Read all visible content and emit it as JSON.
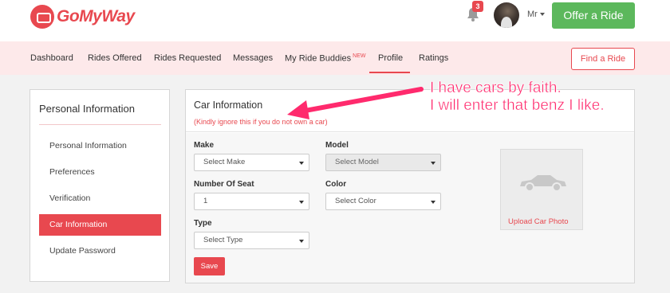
{
  "brand": {
    "name": "GoMyWay",
    "color": "#e8484f"
  },
  "header": {
    "notifications_count": "3",
    "user_name": "Mr",
    "offer_button": "Offer a Ride"
  },
  "nav": {
    "items": [
      "Dashboard",
      "Rides Offered",
      "Rides Requested",
      "Messages",
      "My Ride Buddies",
      "Profile",
      "Ratings"
    ],
    "new_badge": "NEW",
    "active": "Profile",
    "find_button": "Find a Ride"
  },
  "sidebar": {
    "title": "Personal Information",
    "items": [
      "Personal Information",
      "Preferences",
      "Verification",
      "Car Information",
      "Update Password"
    ],
    "active": "Car Information"
  },
  "panel": {
    "title": "Car Information",
    "note": "(Kindly ignore this if you do not own a car)",
    "fields": {
      "make": {
        "label": "Make",
        "value": "Select Make"
      },
      "model": {
        "label": "Model",
        "value": "Select Model"
      },
      "seats": {
        "label": "Number Of Seat",
        "value": "1"
      },
      "color": {
        "label": "Color",
        "value": "Select Color"
      },
      "type": {
        "label": "Type",
        "value": "Select Type"
      }
    },
    "save_button": "Save",
    "upload_label": "Upload Car Photo"
  },
  "annotation": {
    "line1": "I have cars by faith.",
    "line2": "I will enter that benz I like.",
    "color": "#ff2a6d"
  },
  "icons": [
    "bell-icon",
    "caret-down-icon",
    "car-icon",
    "select-arrow-icon"
  ]
}
